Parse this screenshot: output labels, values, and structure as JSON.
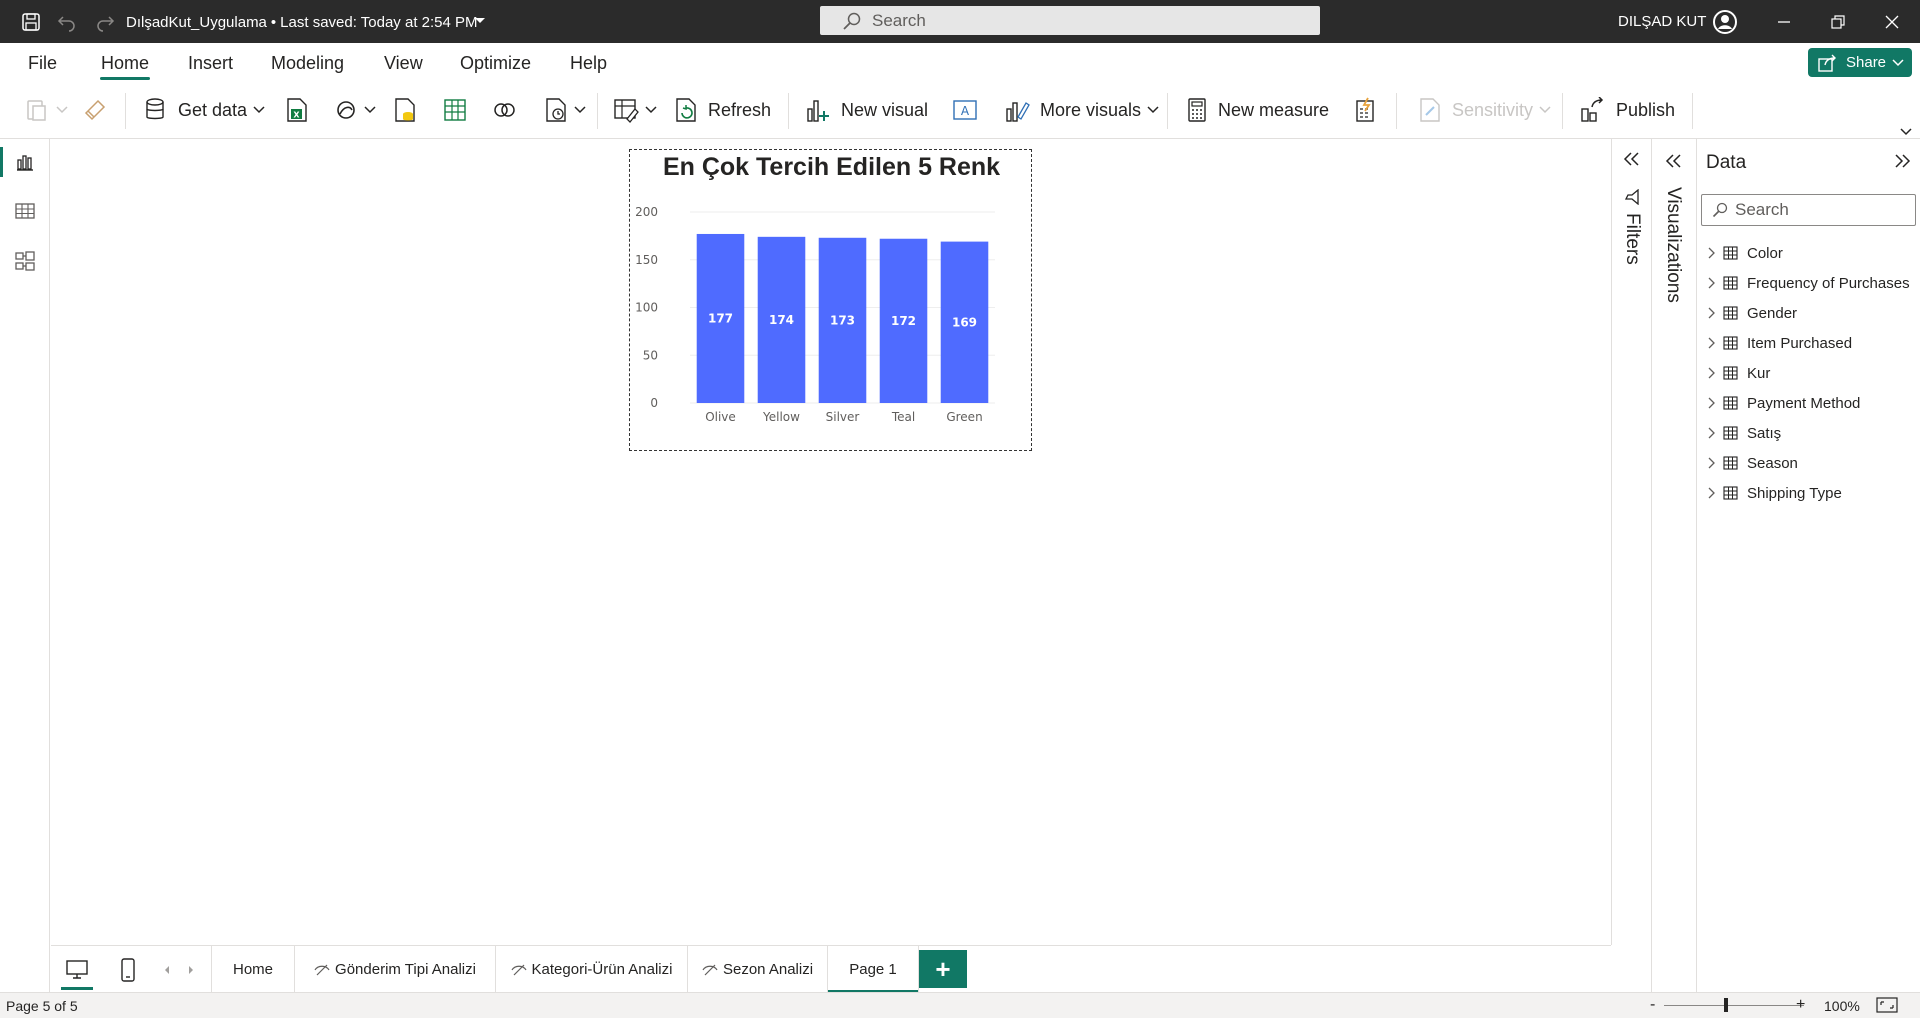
{
  "titlebar": {
    "document_name": "DılşadKut_Uygulama",
    "separator": "•",
    "last_saved": "Last saved: Today at 2:54 PM",
    "search_placeholder": "Search",
    "user_name": "DILŞAD KUT"
  },
  "menu": {
    "tabs": [
      {
        "label": "File"
      },
      {
        "label": "Home"
      },
      {
        "label": "Insert"
      },
      {
        "label": "Modeling"
      },
      {
        "label": "View"
      },
      {
        "label": "Optimize"
      },
      {
        "label": "Help"
      }
    ],
    "active_tab": "Home",
    "share_label": "Share"
  },
  "ribbon": {
    "get_data": "Get data",
    "refresh": "Refresh",
    "new_visual": "New visual",
    "more_visuals": "More visuals",
    "new_measure": "New measure",
    "sensitivity": "Sensitivity",
    "publish": "Publish"
  },
  "chart_data": {
    "type": "bar",
    "title": "En Çok Tercih Edilen 5 Renk",
    "categories": [
      "Olive",
      "Yellow",
      "Silver",
      "Teal",
      "Green"
    ],
    "values": [
      177,
      174,
      173,
      172,
      169
    ],
    "ylim": [
      0,
      200
    ],
    "yticks": [
      0,
      50,
      100,
      150,
      200
    ],
    "bar_color": "#4f6bff",
    "data_labels": "inside",
    "grid": true
  },
  "panes": {
    "filters_label": "Filters",
    "visualizations_label": "Visualizations",
    "data_title": "Data",
    "data_search_placeholder": "Search",
    "tables": [
      {
        "name": "Color"
      },
      {
        "name": "Frequency of Purchases"
      },
      {
        "name": "Gender"
      },
      {
        "name": "Item Purchased"
      },
      {
        "name": "Kur"
      },
      {
        "name": "Payment Method"
      },
      {
        "name": "Satış"
      },
      {
        "name": "Season"
      },
      {
        "name": "Shipping Type"
      }
    ]
  },
  "pages": {
    "tabs": [
      {
        "label": "Home",
        "hidden": false
      },
      {
        "label": "Gönderim Tipi Analizi",
        "hidden": true
      },
      {
        "label": "Kategori-Ürün Analizi",
        "hidden": true
      },
      {
        "label": "Sezon Analizi",
        "hidden": true
      },
      {
        "label": "Page 1",
        "hidden": false
      }
    ],
    "active_page": "Page 1",
    "add_label": "+"
  },
  "status": {
    "page_indicator": "Page 5 of 5",
    "zoom_minus": "-",
    "zoom_plus": "+",
    "zoom": "100%"
  },
  "colors": {
    "accent": "#117865",
    "titlebar_bg": "#2b2b2b",
    "bar": "#4f6bff"
  }
}
